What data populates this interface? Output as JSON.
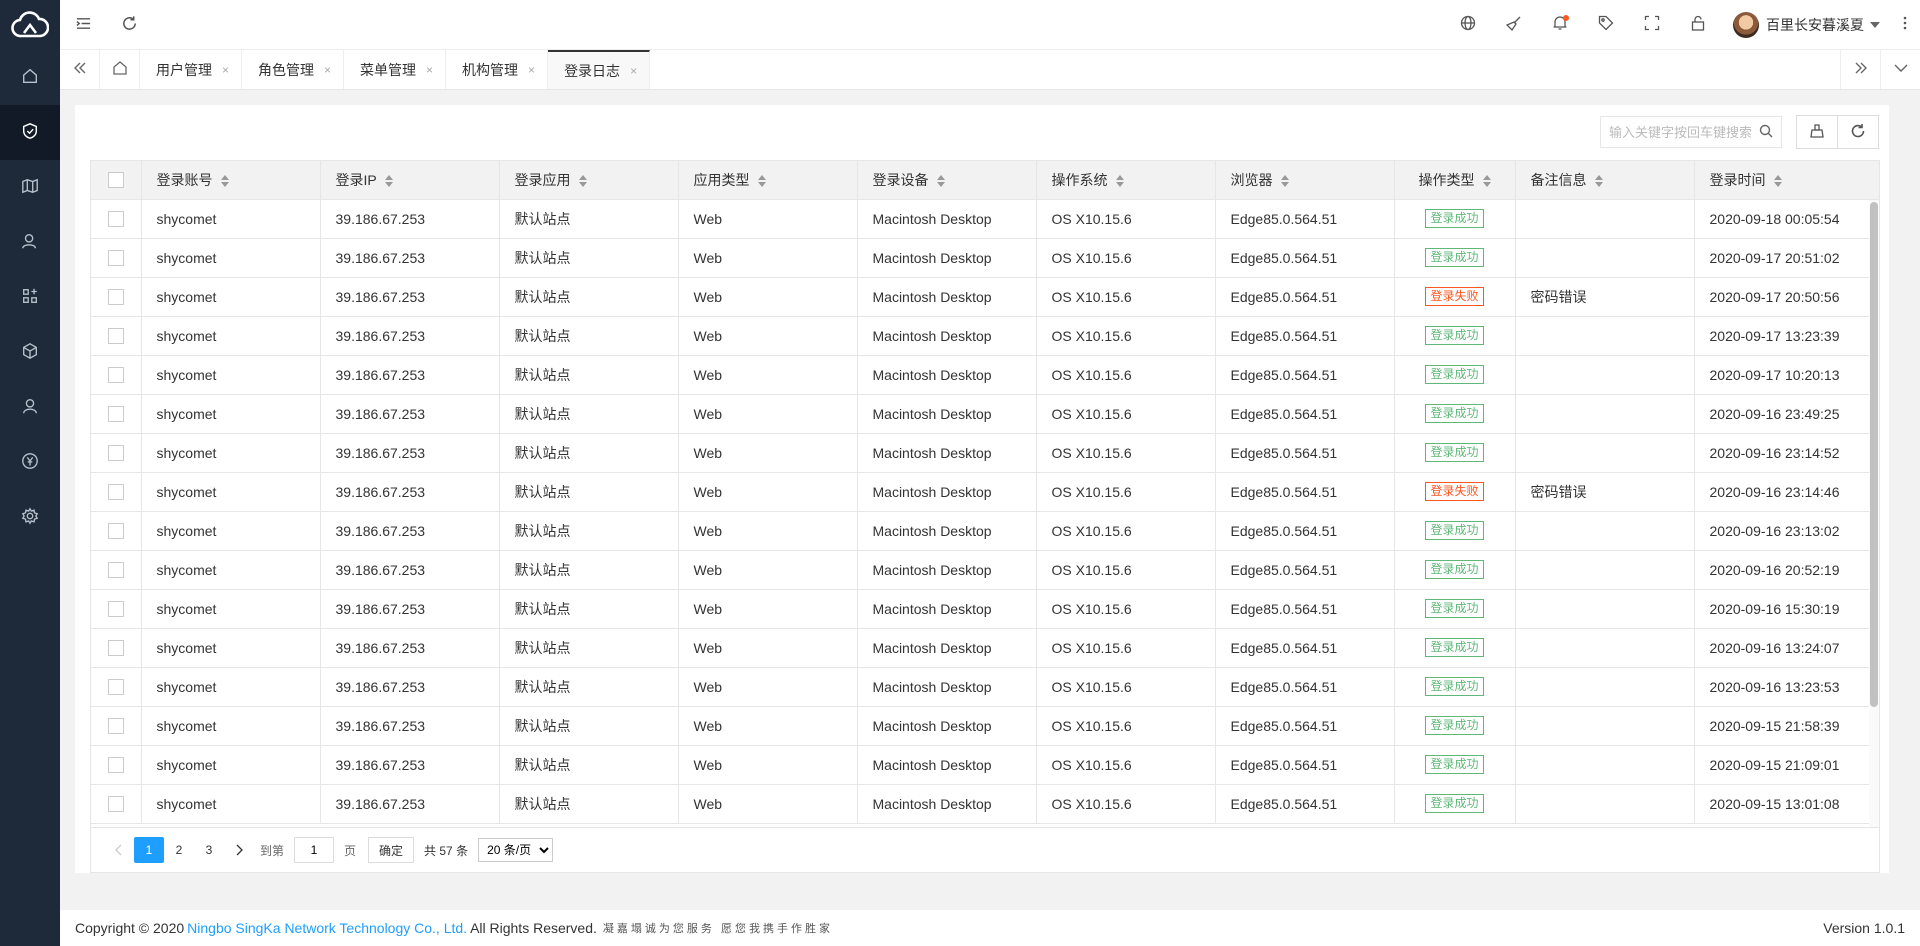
{
  "header": {
    "username": "百里长安暮溪夏"
  },
  "tabs": [
    {
      "label": "用户管理",
      "active": false
    },
    {
      "label": "角色管理",
      "active": false
    },
    {
      "label": "菜单管理",
      "active": false
    },
    {
      "label": "机构管理",
      "active": false
    },
    {
      "label": "登录日志",
      "active": true
    }
  ],
  "tab_close": "×",
  "search": {
    "placeholder": "输入关键字按回车键搜索"
  },
  "table": {
    "columns": [
      "登录账号",
      "登录IP",
      "登录应用",
      "应用类型",
      "登录设备",
      "操作系统",
      "浏览器",
      "操作类型",
      "备注信息",
      "登录时间"
    ],
    "rows": [
      [
        "shycomet",
        "39.186.67.253",
        "默认站点",
        "Web",
        "Macintosh Desktop",
        "OS X10.15.6",
        "Edge85.0.564.51",
        "登录成功",
        "",
        "2020-09-18 00:05:54"
      ],
      [
        "shycomet",
        "39.186.67.253",
        "默认站点",
        "Web",
        "Macintosh Desktop",
        "OS X10.15.6",
        "Edge85.0.564.51",
        "登录成功",
        "",
        "2020-09-17 20:51:02"
      ],
      [
        "shycomet",
        "39.186.67.253",
        "默认站点",
        "Web",
        "Macintosh Desktop",
        "OS X10.15.6",
        "Edge85.0.564.51",
        "登录失败",
        "密码错误",
        "2020-09-17 20:50:56"
      ],
      [
        "shycomet",
        "39.186.67.253",
        "默认站点",
        "Web",
        "Macintosh Desktop",
        "OS X10.15.6",
        "Edge85.0.564.51",
        "登录成功",
        "",
        "2020-09-17 13:23:39"
      ],
      [
        "shycomet",
        "39.186.67.253",
        "默认站点",
        "Web",
        "Macintosh Desktop",
        "OS X10.15.6",
        "Edge85.0.564.51",
        "登录成功",
        "",
        "2020-09-17 10:20:13"
      ],
      [
        "shycomet",
        "39.186.67.253",
        "默认站点",
        "Web",
        "Macintosh Desktop",
        "OS X10.15.6",
        "Edge85.0.564.51",
        "登录成功",
        "",
        "2020-09-16 23:49:25"
      ],
      [
        "shycomet",
        "39.186.67.253",
        "默认站点",
        "Web",
        "Macintosh Desktop",
        "OS X10.15.6",
        "Edge85.0.564.51",
        "登录成功",
        "",
        "2020-09-16 23:14:52"
      ],
      [
        "shycomet",
        "39.186.67.253",
        "默认站点",
        "Web",
        "Macintosh Desktop",
        "OS X10.15.6",
        "Edge85.0.564.51",
        "登录失败",
        "密码错误",
        "2020-09-16 23:14:46"
      ],
      [
        "shycomet",
        "39.186.67.253",
        "默认站点",
        "Web",
        "Macintosh Desktop",
        "OS X10.15.6",
        "Edge85.0.564.51",
        "登录成功",
        "",
        "2020-09-16 23:13:02"
      ],
      [
        "shycomet",
        "39.186.67.253",
        "默认站点",
        "Web",
        "Macintosh Desktop",
        "OS X10.15.6",
        "Edge85.0.564.51",
        "登录成功",
        "",
        "2020-09-16 20:52:19"
      ],
      [
        "shycomet",
        "39.186.67.253",
        "默认站点",
        "Web",
        "Macintosh Desktop",
        "OS X10.15.6",
        "Edge85.0.564.51",
        "登录成功",
        "",
        "2020-09-16 15:30:19"
      ],
      [
        "shycomet",
        "39.186.67.253",
        "默认站点",
        "Web",
        "Macintosh Desktop",
        "OS X10.15.6",
        "Edge85.0.564.51",
        "登录成功",
        "",
        "2020-09-16 13:24:07"
      ],
      [
        "shycomet",
        "39.186.67.253",
        "默认站点",
        "Web",
        "Macintosh Desktop",
        "OS X10.15.6",
        "Edge85.0.564.51",
        "登录成功",
        "",
        "2020-09-16 13:23:53"
      ],
      [
        "shycomet",
        "39.186.67.253",
        "默认站点",
        "Web",
        "Macintosh Desktop",
        "OS X10.15.6",
        "Edge85.0.564.51",
        "登录成功",
        "",
        "2020-09-15 21:58:39"
      ],
      [
        "shycomet",
        "39.186.67.253",
        "默认站点",
        "Web",
        "Macintosh Desktop",
        "OS X10.15.6",
        "Edge85.0.564.51",
        "登录成功",
        "",
        "2020-09-15 21:09:01"
      ],
      [
        "shycomet",
        "39.186.67.253",
        "默认站点",
        "Web",
        "Macintosh Desktop",
        "OS X10.15.6",
        "Edge85.0.564.51",
        "登录成功",
        "",
        "2020-09-15 13:01:08"
      ]
    ]
  },
  "pager": {
    "pages": [
      "1",
      "2",
      "3"
    ],
    "current": "1",
    "goto_label": "到第",
    "goto_value": "1",
    "page_unit": "页",
    "confirm": "确定",
    "total": "共 57 条",
    "page_size": "20 条/页"
  },
  "footer": {
    "copyright": "Copyright © 2020",
    "company": "Ningbo SingKa Network Technology Co., Ltd.",
    "rights": "All Rights Reserved.",
    "slogan": "凝嘉塌诚为您服务 愿您我携手作胜家",
    "version": "Version 1.0.1"
  },
  "colors": {
    "sidebar_bg": "#1e2a3a",
    "accent": "#1e9fff",
    "success": "#5fb878",
    "danger": "#ff5722"
  }
}
